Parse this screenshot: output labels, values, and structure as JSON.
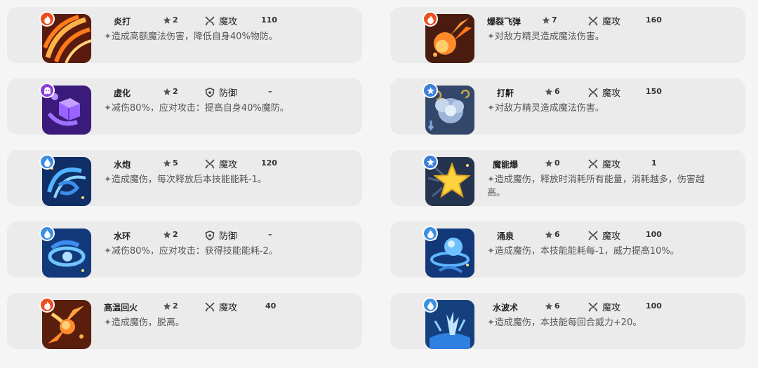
{
  "skills": [
    {
      "name": "炎打",
      "stars": "2",
      "type": "魔攻",
      "power": "110",
      "desc": "造成高额魔法伤害，降低自身40%物防。",
      "element": "fire",
      "art": "fire-claw",
      "category": "attack"
    },
    {
      "name": "爆裂飞弹",
      "stars": "7",
      "type": "魔攻",
      "power": "160",
      "desc": "对敌方精灵造成魔法伤害。",
      "element": "fire",
      "art": "fireball",
      "category": "attack"
    },
    {
      "name": "虚化",
      "stars": "2",
      "type": "防御",
      "power": "–",
      "desc": "减伤80%，应对攻击：提高自身40%魔防。",
      "element": "ghost",
      "art": "ghost-cube",
      "category": "defense"
    },
    {
      "name": "打鼾",
      "stars": "6",
      "type": "魔攻",
      "power": "150",
      "desc": "对敌方精灵造成魔法伤害。",
      "element": "normal",
      "art": "snore",
      "category": "attack"
    },
    {
      "name": "水炮",
      "stars": "5",
      "type": "魔攻",
      "power": "120",
      "desc": "造成魔伤，每次释放后本技能能耗-1。",
      "element": "water",
      "art": "water-swirl",
      "category": "attack"
    },
    {
      "name": "魔能爆",
      "stars": "0",
      "type": "魔攻",
      "power": "1",
      "desc": "造成魔伤，释放时消耗所有能量，消耗越多，伤害越高。",
      "element": "normal",
      "art": "star-burst",
      "category": "attack"
    },
    {
      "name": "水环",
      "stars": "2",
      "type": "防御",
      "power": "–",
      "desc": "减伤80%，应对攻击：获得技能能耗-2。",
      "element": "water",
      "art": "water-ring",
      "category": "defense"
    },
    {
      "name": "涌泉",
      "stars": "6",
      "type": "魔攻",
      "power": "100",
      "desc": "造成魔伤，本技能能耗每-1，威力提高10%。",
      "element": "water",
      "art": "water-spring",
      "category": "attack"
    },
    {
      "name": "高温回火",
      "stars": "2",
      "type": "魔攻",
      "power": "40",
      "desc": "造成魔伤，脱离。",
      "element": "fire",
      "art": "fire-comet",
      "category": "attack"
    },
    {
      "name": "水波术",
      "stars": "6",
      "type": "魔攻",
      "power": "100",
      "desc": "造成魔伤，本技能每回合威力+20。",
      "element": "water",
      "art": "water-splash",
      "category": "attack"
    }
  ],
  "colors": {
    "fire_badge": "#e8501f",
    "ghost_badge": "#8a3fe0",
    "water_badge": "#3d8fe0",
    "normal_badge": "#3d7fd9"
  }
}
